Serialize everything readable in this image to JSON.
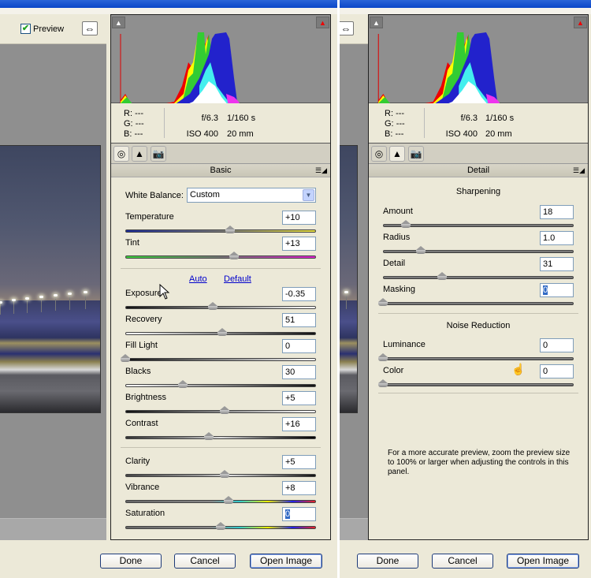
{
  "left": {
    "preview": {
      "label": "Preview",
      "checked": true
    },
    "swap_icon": "swap-horizontal-icon",
    "histogram": {
      "shadow_clip_icon": "shadow-clipping-warning-icon",
      "highlight_clip_icon": "highlight-clipping-warning-icon"
    },
    "rgb": {
      "r_label": "R:",
      "r_value": "---",
      "g_label": "G:",
      "g_value": "---",
      "b_label": "B:",
      "b_value": "---"
    },
    "exif": {
      "aperture": "f/6.3",
      "shutter": "1/160 s",
      "iso": "ISO 400",
      "focal": "20 mm"
    },
    "tabs": [
      {
        "name": "basic",
        "icon": "aperture-icon",
        "active": true
      },
      {
        "name": "tone-curve",
        "icon": "mountains-icon",
        "active": false
      },
      {
        "name": "camera-calibration",
        "icon": "camera-icon",
        "active": false
      }
    ],
    "section_title": "Basic",
    "white_balance": {
      "label": "White Balance:",
      "value": "Custom"
    },
    "auto_label": "Auto",
    "default_label": "Default",
    "sliders_wb": [
      {
        "label": "Temperature",
        "value": "+10",
        "position": 0.55
      },
      {
        "label": "Tint",
        "value": "+13",
        "position": 0.57
      }
    ],
    "sliders_tone": [
      {
        "label": "Exposure",
        "value": "-0.35",
        "position": 0.46
      },
      {
        "label": "Recovery",
        "value": "51",
        "position": 0.51
      },
      {
        "label": "Fill Light",
        "value": "0",
        "position": 0.0
      },
      {
        "label": "Blacks",
        "value": "30",
        "position": 0.3
      },
      {
        "label": "Brightness",
        "value": "+5",
        "position": 0.52
      },
      {
        "label": "Contrast",
        "value": "+16",
        "position": 0.44
      }
    ],
    "sliders_presence": [
      {
        "label": "Clarity",
        "value": "+5",
        "position": 0.52
      },
      {
        "label": "Vibrance",
        "value": "+8",
        "position": 0.54
      },
      {
        "label": "Saturation",
        "value": "0",
        "position": 0.5,
        "selected": true
      }
    ]
  },
  "right": {
    "swap_icon": "swap-horizontal-icon",
    "rgb": {
      "r_label": "R:",
      "r_value": "---",
      "g_label": "G:",
      "g_value": "---",
      "b_label": "B:",
      "b_value": "---"
    },
    "exif": {
      "aperture": "f/6.3",
      "shutter": "1/160 s",
      "iso": "ISO 400",
      "focal": "20 mm"
    },
    "section_title": "Detail",
    "sharpening_title": "Sharpening",
    "sharpening": [
      {
        "label": "Amount",
        "value": "18",
        "position": 0.12
      },
      {
        "label": "Radius",
        "value": "1.0",
        "position": 0.2
      },
      {
        "label": "Detail",
        "value": "31",
        "position": 0.31
      },
      {
        "label": "Masking",
        "value": "0",
        "position": 0.0,
        "selected": true
      }
    ],
    "noise_title": "Noise Reduction",
    "noise": [
      {
        "label": "Luminance",
        "value": "0",
        "position": 0.0
      },
      {
        "label": "Color",
        "value": "0",
        "position": 0.0
      }
    ],
    "note": "For a more accurate preview, zoom the preview size to 100% or larger when adjusting the controls in this panel."
  },
  "buttons": {
    "done": "Done",
    "cancel": "Cancel",
    "open_image": "Open Image"
  },
  "colors": {
    "link": "#0000cc",
    "selection": "#316ac5",
    "titlebar": "#0a46c8"
  }
}
